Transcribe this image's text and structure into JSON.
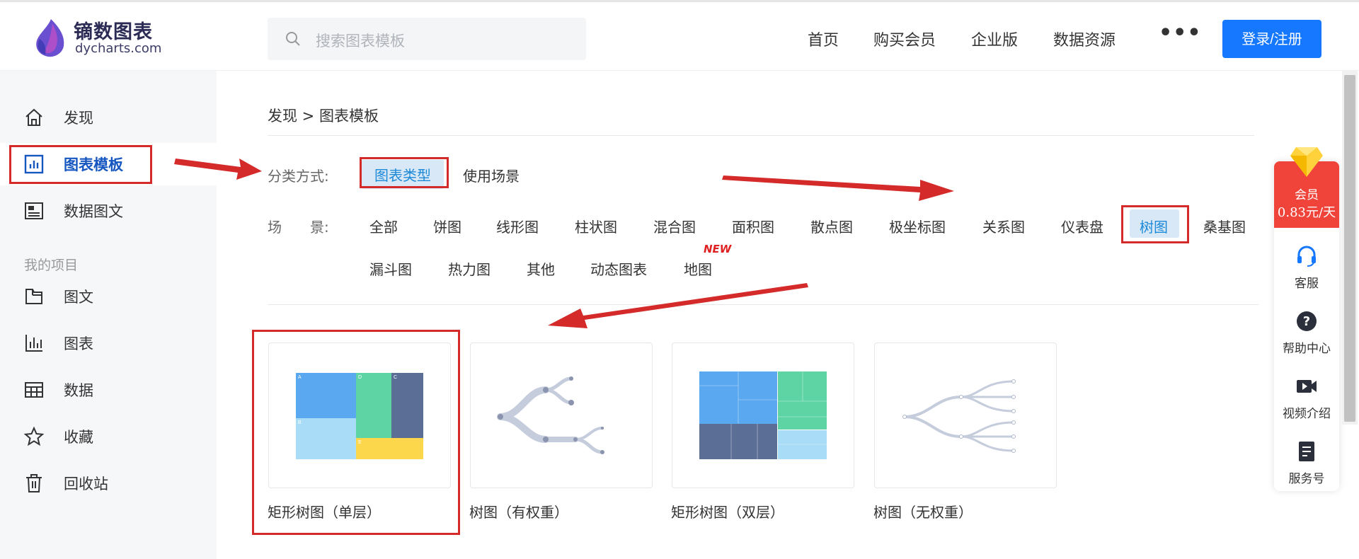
{
  "brand": {
    "name_cn": "镝数图表",
    "name_en": "dycharts.com"
  },
  "search": {
    "placeholder": "搜索图表模板"
  },
  "nav": {
    "items": [
      "首页",
      "购买会员",
      "企业版",
      "数据资源"
    ],
    "more": "•••",
    "login": "登录/注册"
  },
  "sidebar": {
    "items": [
      {
        "label": "发现",
        "icon": "home-icon"
      },
      {
        "label": "图表模板",
        "icon": "chart-template-icon",
        "active": true
      },
      {
        "label": "数据图文",
        "icon": "data-article-icon"
      }
    ],
    "section_title": "我的项目",
    "project_items": [
      {
        "label": "图文",
        "icon": "folder-icon"
      },
      {
        "label": "图表",
        "icon": "bar-chart-icon"
      },
      {
        "label": "数据",
        "icon": "table-icon"
      },
      {
        "label": "收藏",
        "icon": "star-icon"
      },
      {
        "label": "回收站",
        "icon": "trash-icon"
      }
    ]
  },
  "breadcrumb": "发现 > 图表模板",
  "filter": {
    "method_label": "分类方式:",
    "method_tabs": [
      "图表类型",
      "使用场景"
    ],
    "scene_label": "场　　景:",
    "scenes_row1": [
      "全部",
      "饼图",
      "线形图",
      "柱状图",
      "混合图",
      "面积图",
      "散点图",
      "极坐标图",
      "关系图",
      "仪表盘",
      "树图",
      "桑基图"
    ],
    "scenes_row2": [
      "漏斗图",
      "热力图",
      "其他",
      "动态图表",
      "地图"
    ],
    "active_scene": "树图",
    "new_badge": "NEW"
  },
  "cards": [
    {
      "title": "矩形树图（单层）",
      "thumb": "treemap-single",
      "labels": [
        "A",
        "D",
        "C",
        "B",
        "E"
      ]
    },
    {
      "title": "树图（有权重）",
      "thumb": "tree-weighted"
    },
    {
      "title": "矩形树图（双层）",
      "thumb": "treemap-double"
    },
    {
      "title": "树图（无权重）",
      "thumb": "tree-unweighted"
    }
  ],
  "float_panel": {
    "vip_line1": "会员",
    "vip_line2": "0.83元/天",
    "items": [
      {
        "label": "客服",
        "icon": "headset-icon"
      },
      {
        "label": "帮助中心",
        "icon": "question-icon"
      },
      {
        "label": "视频介绍",
        "icon": "video-icon"
      },
      {
        "label": "服务号",
        "icon": "document-icon"
      }
    ]
  },
  "colors": {
    "accent": "#1677ff",
    "active_text": "#1d8ad8",
    "active_bg": "#d8e8f7",
    "annotation_red": "#d42a2a",
    "vip_red": "#f0433a"
  }
}
